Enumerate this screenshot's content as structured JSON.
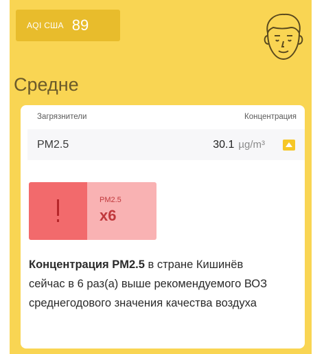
{
  "header": {
    "aqi_label": "AQI США",
    "aqi_value": "89",
    "status": "Средне"
  },
  "table": {
    "col_pollutant": "Загрязнители",
    "col_concentration": "Концентрация",
    "rows": [
      {
        "name": "PM2.5",
        "value": "30.1",
        "unit": "µg/m³"
      }
    ]
  },
  "ratio": {
    "alert_symbol": "!",
    "pollutant": "PM2.5",
    "multiplier": "x6"
  },
  "description": {
    "bold": "Концентрация PM2.5",
    "text": " в стране Кишинёв сейчас в 6 раз(а) выше рекомендуемого ВОЗ среднегодового значения качества воздуха"
  },
  "colors": {
    "panel": "#f9d553",
    "badge": "#e8bc2c",
    "alert": "#f26a6c",
    "alert_light": "#f9b2b3",
    "accent": "#f6c727"
  }
}
